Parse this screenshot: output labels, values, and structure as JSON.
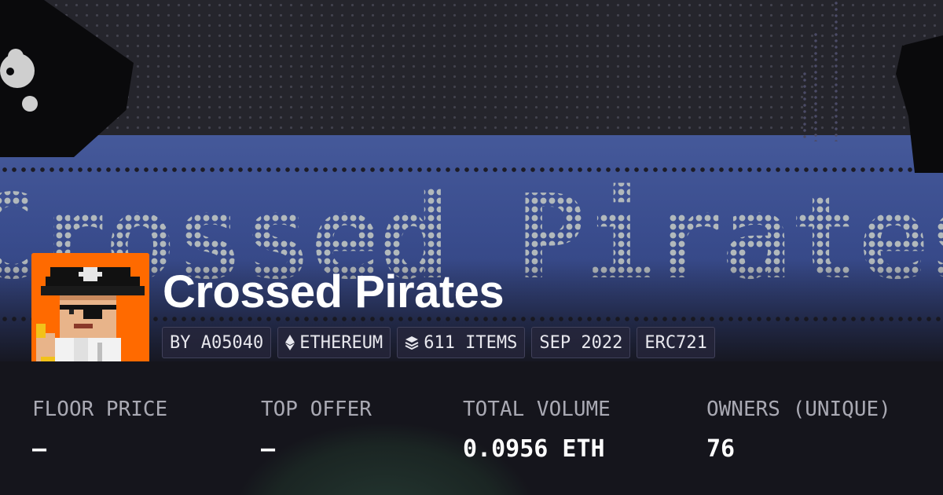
{
  "collection": {
    "name": "Crossed Pirates",
    "banner_text": "Crossed Pirates"
  },
  "chips": [
    {
      "label": "BY A05040",
      "icon": null
    },
    {
      "label": "ETHEREUM",
      "icon": "ethereum-icon"
    },
    {
      "label": "611 ITEMS",
      "icon": "layers-icon"
    },
    {
      "label": "SEP 2022",
      "icon": null
    },
    {
      "label": "ERC721",
      "icon": null
    }
  ],
  "stats": {
    "floor_price": {
      "label": "FLOOR PRICE",
      "value": "–"
    },
    "top_offer": {
      "label": "TOP OFFER",
      "value": "–"
    },
    "total_volume": {
      "label": "TOTAL VOLUME",
      "value": "0.0956 ETH"
    },
    "owners": {
      "label": "OWNERS (UNIQUE)",
      "value": "76"
    }
  },
  "colors": {
    "background": "#15151c",
    "banner_stripe": "#3a4d8e",
    "avatar_background": "#ff6a00",
    "label": "#a9a9b3",
    "value": "#ffffff"
  }
}
